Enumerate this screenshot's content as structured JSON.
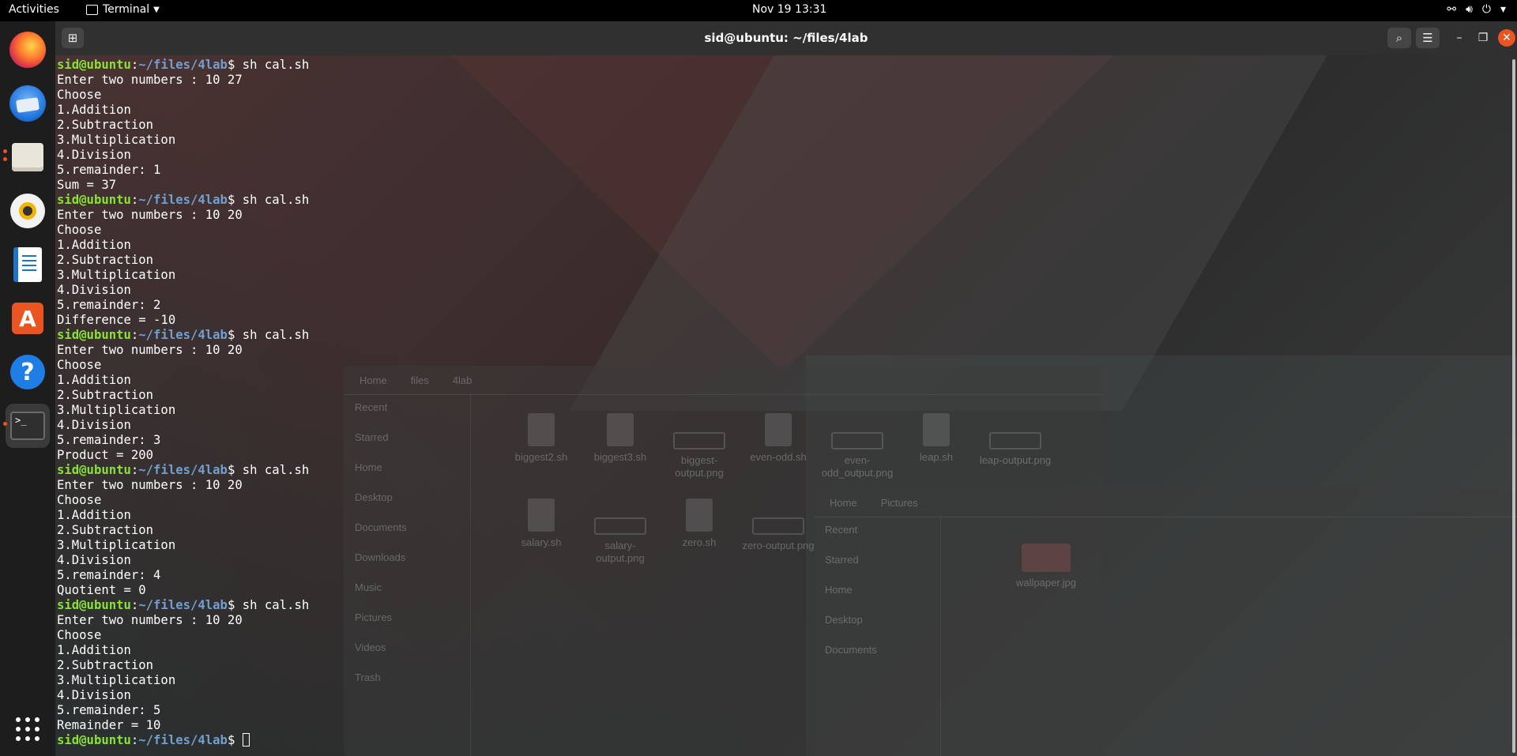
{
  "topbar": {
    "activities": "Activities",
    "app_menu": "Terminal",
    "clock": "Nov 19  13:31",
    "tray_icons": [
      "network-icon",
      "volume-icon",
      "power-icon",
      "menu-caret-icon"
    ]
  },
  "dock": {
    "apps": [
      {
        "name": "firefox",
        "running": false
      },
      {
        "name": "thunderbird",
        "running": false
      },
      {
        "name": "files",
        "running": true
      },
      {
        "name": "rhythmbox",
        "running": false
      },
      {
        "name": "libreoffice-writer",
        "running": false
      },
      {
        "name": "ubuntu-software",
        "running": false
      },
      {
        "name": "help",
        "running": false
      },
      {
        "name": "terminal",
        "running": true
      }
    ],
    "show_apps": "show-applications-icon",
    "accent_color": "#e95420"
  },
  "window": {
    "title": "sid@ubuntu: ~/files/4lab"
  },
  "terminal": {
    "user_host": "sid@ubuntu",
    "path": "~/files/4lab",
    "colors": {
      "user": "#8ae234",
      "path": "#729fcf",
      "text": "#ffffff"
    },
    "sessions": [
      {
        "command": "sh cal.sh",
        "input": "Enter two numbers : 10 27",
        "choose": "Choose",
        "options": [
          "1.Addition",
          "2.Subtraction",
          "3.Multiplication",
          "4.Division"
        ],
        "prompt": "5.remainder: 1",
        "result": "Sum = 37"
      },
      {
        "command": "sh cal.sh",
        "input": "Enter two numbers : 10 20",
        "choose": "Choose",
        "options": [
          "1.Addition",
          "2.Subtraction",
          "3.Multiplication",
          "4.Division"
        ],
        "prompt": "5.remainder: 2",
        "result": "Difference = -10"
      },
      {
        "command": "sh cal.sh",
        "input": "Enter two numbers : 10 20",
        "choose": "Choose",
        "options": [
          "1.Addition",
          "2.Subtraction",
          "3.Multiplication",
          "4.Division"
        ],
        "prompt": "5.remainder: 3",
        "result": "Product = 200"
      },
      {
        "command": "sh cal.sh",
        "input": "Enter two numbers : 10 20",
        "choose": "Choose",
        "options": [
          "1.Addition",
          "2.Subtraction",
          "3.Multiplication",
          "4.Division"
        ],
        "prompt": "5.remainder: 4",
        "result": "Quotient = 0"
      },
      {
        "command": "sh cal.sh",
        "input": "Enter two numbers : 10 20",
        "choose": "Choose",
        "options": [
          "1.Addition",
          "2.Subtraction",
          "3.Multiplication",
          "4.Division"
        ],
        "prompt": "5.remainder: 5",
        "result": "Remainder = 10"
      }
    ]
  },
  "background_files_window": {
    "path": [
      "Home",
      "files",
      "4lab"
    ],
    "sidebar": [
      "Recent",
      "Starred",
      "Home",
      "Desktop",
      "Documents",
      "Downloads",
      "Music",
      "Pictures",
      "Videos",
      "Trash"
    ],
    "files": [
      "biggest2.sh",
      "biggest3.sh",
      "biggest-output.png",
      "even-odd.sh",
      "even-odd_output.png",
      "leap.sh",
      "leap-output.png",
      "salary.sh",
      "salary-output.png",
      "zero.sh",
      "zero-output.png"
    ]
  },
  "background_pictures_window": {
    "path": [
      "Home",
      "Pictures"
    ],
    "sidebar": [
      "Recent",
      "Starred",
      "Home",
      "Desktop",
      "Documents"
    ],
    "files": [
      "wallpaper.jpg"
    ]
  }
}
